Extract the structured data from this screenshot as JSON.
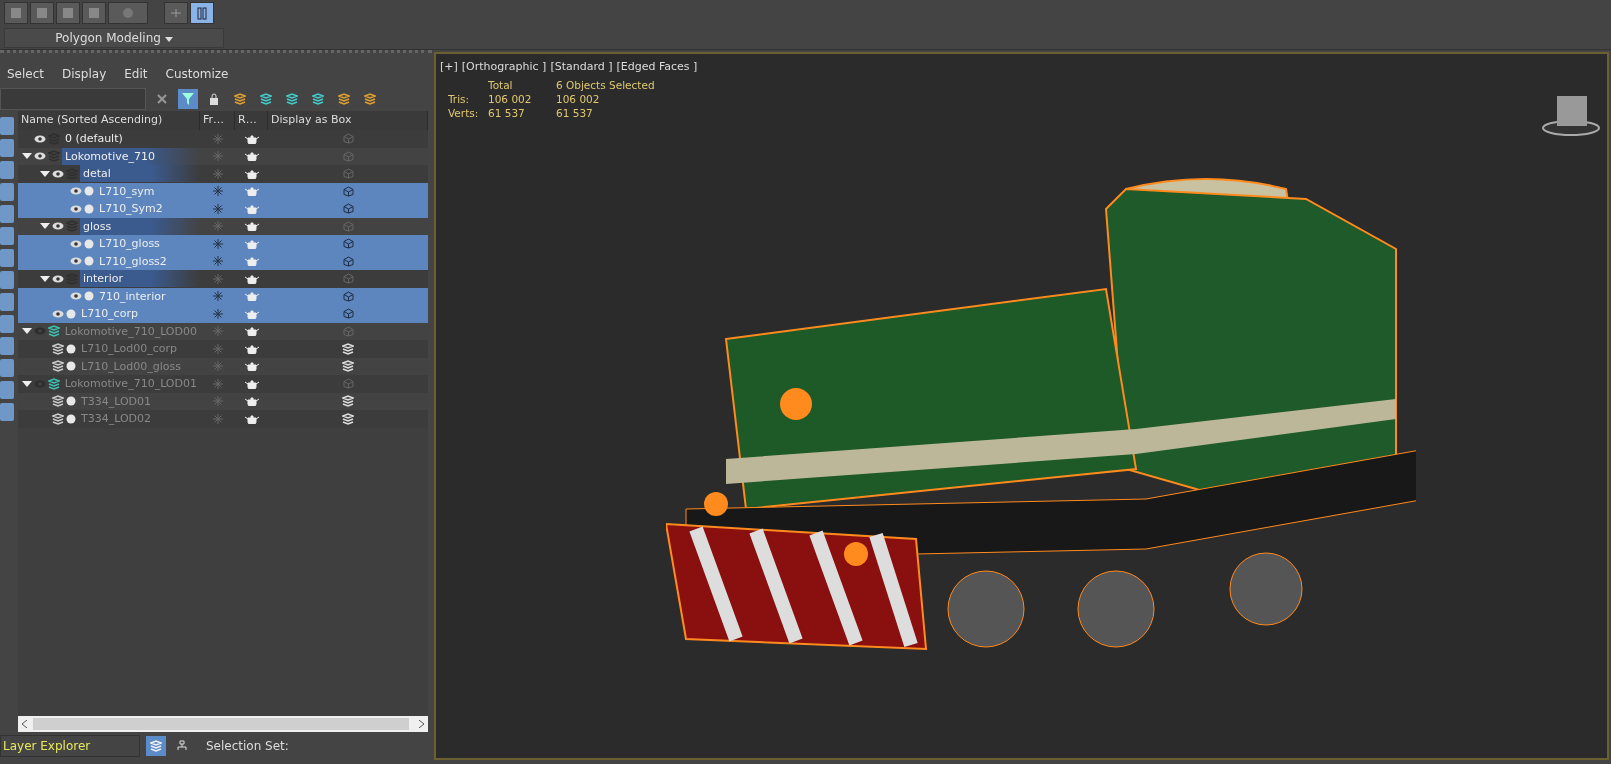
{
  "ribbon": {
    "panel_label": "Polygon Modeling"
  },
  "menu": [
    "Select",
    "Display",
    "Edit",
    "Customize"
  ],
  "columns": [
    "Name (Sorted Ascending)",
    "Fr…",
    "R…",
    "Display as Box"
  ],
  "tree": [
    {
      "name": "0 (default)",
      "kind": "layer",
      "visible": true,
      "selected": false,
      "highlighted": false
    },
    {
      "name": "Lokomotive_710",
      "kind": "layer",
      "visible": true,
      "selected": false,
      "highlighted": true,
      "expanded": true,
      "children": [
        {
          "name": "detal",
          "kind": "layer",
          "visible": true,
          "selected": false,
          "highlighted": true,
          "expanded": true,
          "children": [
            {
              "name": "L710_sym",
              "kind": "object",
              "visible": true,
              "selected": true
            },
            {
              "name": "L710_Sym2",
              "kind": "object",
              "visible": true,
              "selected": true
            }
          ]
        },
        {
          "name": "gloss",
          "kind": "layer",
          "visible": true,
          "selected": false,
          "highlighted": true,
          "expanded": true,
          "children": [
            {
              "name": "L710_gloss",
              "kind": "object",
              "visible": true,
              "selected": true
            },
            {
              "name": "L710_gloss2",
              "kind": "object",
              "visible": true,
              "selected": true
            }
          ]
        },
        {
          "name": "interior",
          "kind": "layer",
          "visible": true,
          "selected": false,
          "highlighted": true,
          "expanded": true,
          "children": [
            {
              "name": "710_interior",
              "kind": "object",
              "visible": true,
              "selected": true
            }
          ]
        },
        {
          "name": "L710_corp",
          "kind": "object",
          "visible": true,
          "selected": true
        }
      ]
    },
    {
      "name": "Lokomotive_710_LOD00",
      "kind": "layer",
      "visible": false,
      "selected": false,
      "highlighted": false,
      "expanded": true,
      "children": [
        {
          "name": "L710_Lod00_corp",
          "kind": "object",
          "visible": false,
          "selected": false
        },
        {
          "name": "L710_Lod00_gloss",
          "kind": "object",
          "visible": false,
          "selected": false
        }
      ]
    },
    {
      "name": "Lokomotive_710_LOD01",
      "kind": "layer",
      "visible": false,
      "selected": false,
      "highlighted": false,
      "expanded": true,
      "children": [
        {
          "name": "T334_LOD01",
          "kind": "object",
          "visible": false,
          "selected": false
        },
        {
          "name": "T334_LOD02",
          "kind": "object",
          "visible": false,
          "selected": false
        }
      ]
    }
  ],
  "footer": {
    "explorer": "Layer Explorer",
    "selection_set_label": "Selection Set:"
  },
  "viewport": {
    "labels": [
      "[+]",
      "[Orthographic ]",
      "[Standard ]",
      "[Edged Faces ]"
    ],
    "stats": {
      "headers": [
        "Total",
        "6 Objects Selected"
      ],
      "rows": [
        {
          "label": "Tris:",
          "total": "106 002",
          "selected": "106 002"
        },
        {
          "label": "Verts:",
          "total": "61 537",
          "selected": "61 537"
        }
      ]
    }
  }
}
